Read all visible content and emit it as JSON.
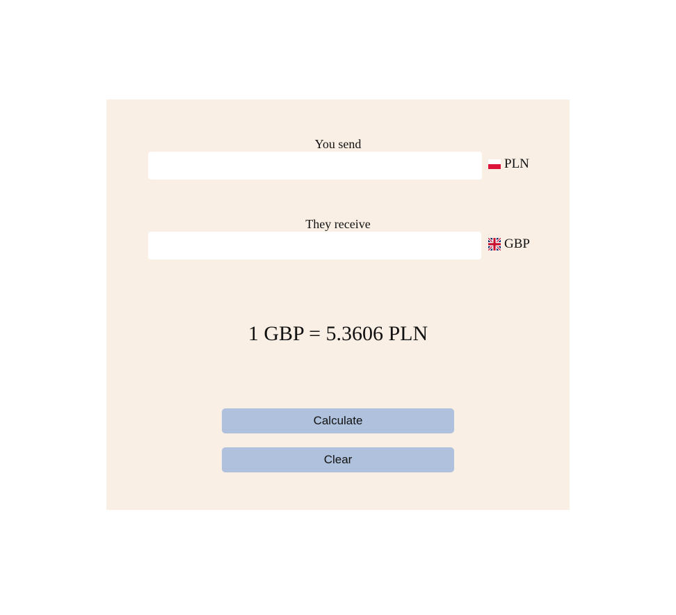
{
  "send": {
    "label": "You send",
    "value": "",
    "currency": "PLN",
    "flag_icon": "poland-flag-icon"
  },
  "receive": {
    "label": "They receive",
    "value": "",
    "currency": "GBP",
    "flag_icon": "uk-flag-icon"
  },
  "rate_text": "1 GBP = 5.3606 PLN",
  "buttons": {
    "calculate": "Calculate",
    "clear": "Clear"
  },
  "colors": {
    "panel_background": "#faefe5",
    "button_background": "#afc1dc"
  }
}
